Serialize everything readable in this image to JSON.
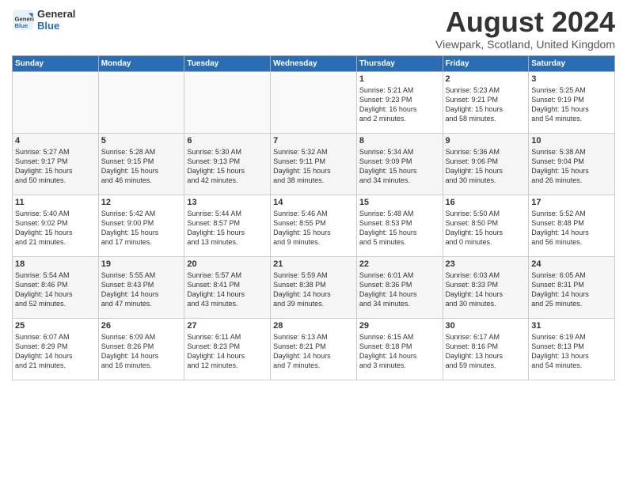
{
  "header": {
    "logo_general": "General",
    "logo_blue": "Blue",
    "month_title": "August 2024",
    "location": "Viewpark, Scotland, United Kingdom"
  },
  "weekdays": [
    "Sunday",
    "Monday",
    "Tuesday",
    "Wednesday",
    "Thursday",
    "Friday",
    "Saturday"
  ],
  "weeks": [
    [
      {
        "day": "",
        "info": ""
      },
      {
        "day": "",
        "info": ""
      },
      {
        "day": "",
        "info": ""
      },
      {
        "day": "",
        "info": ""
      },
      {
        "day": "1",
        "info": "Sunrise: 5:21 AM\nSunset: 9:23 PM\nDaylight: 16 hours\nand 2 minutes."
      },
      {
        "day": "2",
        "info": "Sunrise: 5:23 AM\nSunset: 9:21 PM\nDaylight: 15 hours\nand 58 minutes."
      },
      {
        "day": "3",
        "info": "Sunrise: 5:25 AM\nSunset: 9:19 PM\nDaylight: 15 hours\nand 54 minutes."
      }
    ],
    [
      {
        "day": "4",
        "info": "Sunrise: 5:27 AM\nSunset: 9:17 PM\nDaylight: 15 hours\nand 50 minutes."
      },
      {
        "day": "5",
        "info": "Sunrise: 5:28 AM\nSunset: 9:15 PM\nDaylight: 15 hours\nand 46 minutes."
      },
      {
        "day": "6",
        "info": "Sunrise: 5:30 AM\nSunset: 9:13 PM\nDaylight: 15 hours\nand 42 minutes."
      },
      {
        "day": "7",
        "info": "Sunrise: 5:32 AM\nSunset: 9:11 PM\nDaylight: 15 hours\nand 38 minutes."
      },
      {
        "day": "8",
        "info": "Sunrise: 5:34 AM\nSunset: 9:09 PM\nDaylight: 15 hours\nand 34 minutes."
      },
      {
        "day": "9",
        "info": "Sunrise: 5:36 AM\nSunset: 9:06 PM\nDaylight: 15 hours\nand 30 minutes."
      },
      {
        "day": "10",
        "info": "Sunrise: 5:38 AM\nSunset: 9:04 PM\nDaylight: 15 hours\nand 26 minutes."
      }
    ],
    [
      {
        "day": "11",
        "info": "Sunrise: 5:40 AM\nSunset: 9:02 PM\nDaylight: 15 hours\nand 21 minutes."
      },
      {
        "day": "12",
        "info": "Sunrise: 5:42 AM\nSunset: 9:00 PM\nDaylight: 15 hours\nand 17 minutes."
      },
      {
        "day": "13",
        "info": "Sunrise: 5:44 AM\nSunset: 8:57 PM\nDaylight: 15 hours\nand 13 minutes."
      },
      {
        "day": "14",
        "info": "Sunrise: 5:46 AM\nSunset: 8:55 PM\nDaylight: 15 hours\nand 9 minutes."
      },
      {
        "day": "15",
        "info": "Sunrise: 5:48 AM\nSunset: 8:53 PM\nDaylight: 15 hours\nand 5 minutes."
      },
      {
        "day": "16",
        "info": "Sunrise: 5:50 AM\nSunset: 8:50 PM\nDaylight: 15 hours\nand 0 minutes."
      },
      {
        "day": "17",
        "info": "Sunrise: 5:52 AM\nSunset: 8:48 PM\nDaylight: 14 hours\nand 56 minutes."
      }
    ],
    [
      {
        "day": "18",
        "info": "Sunrise: 5:54 AM\nSunset: 8:46 PM\nDaylight: 14 hours\nand 52 minutes."
      },
      {
        "day": "19",
        "info": "Sunrise: 5:55 AM\nSunset: 8:43 PM\nDaylight: 14 hours\nand 47 minutes."
      },
      {
        "day": "20",
        "info": "Sunrise: 5:57 AM\nSunset: 8:41 PM\nDaylight: 14 hours\nand 43 minutes."
      },
      {
        "day": "21",
        "info": "Sunrise: 5:59 AM\nSunset: 8:38 PM\nDaylight: 14 hours\nand 39 minutes."
      },
      {
        "day": "22",
        "info": "Sunrise: 6:01 AM\nSunset: 8:36 PM\nDaylight: 14 hours\nand 34 minutes."
      },
      {
        "day": "23",
        "info": "Sunrise: 6:03 AM\nSunset: 8:33 PM\nDaylight: 14 hours\nand 30 minutes."
      },
      {
        "day": "24",
        "info": "Sunrise: 6:05 AM\nSunset: 8:31 PM\nDaylight: 14 hours\nand 25 minutes."
      }
    ],
    [
      {
        "day": "25",
        "info": "Sunrise: 6:07 AM\nSunset: 8:29 PM\nDaylight: 14 hours\nand 21 minutes."
      },
      {
        "day": "26",
        "info": "Sunrise: 6:09 AM\nSunset: 8:26 PM\nDaylight: 14 hours\nand 16 minutes."
      },
      {
        "day": "27",
        "info": "Sunrise: 6:11 AM\nSunset: 8:23 PM\nDaylight: 14 hours\nand 12 minutes."
      },
      {
        "day": "28",
        "info": "Sunrise: 6:13 AM\nSunset: 8:21 PM\nDaylight: 14 hours\nand 7 minutes."
      },
      {
        "day": "29",
        "info": "Sunrise: 6:15 AM\nSunset: 8:18 PM\nDaylight: 14 hours\nand 3 minutes."
      },
      {
        "day": "30",
        "info": "Sunrise: 6:17 AM\nSunset: 8:16 PM\nDaylight: 13 hours\nand 59 minutes."
      },
      {
        "day": "31",
        "info": "Sunrise: 6:19 AM\nSunset: 8:13 PM\nDaylight: 13 hours\nand 54 minutes."
      }
    ]
  ]
}
